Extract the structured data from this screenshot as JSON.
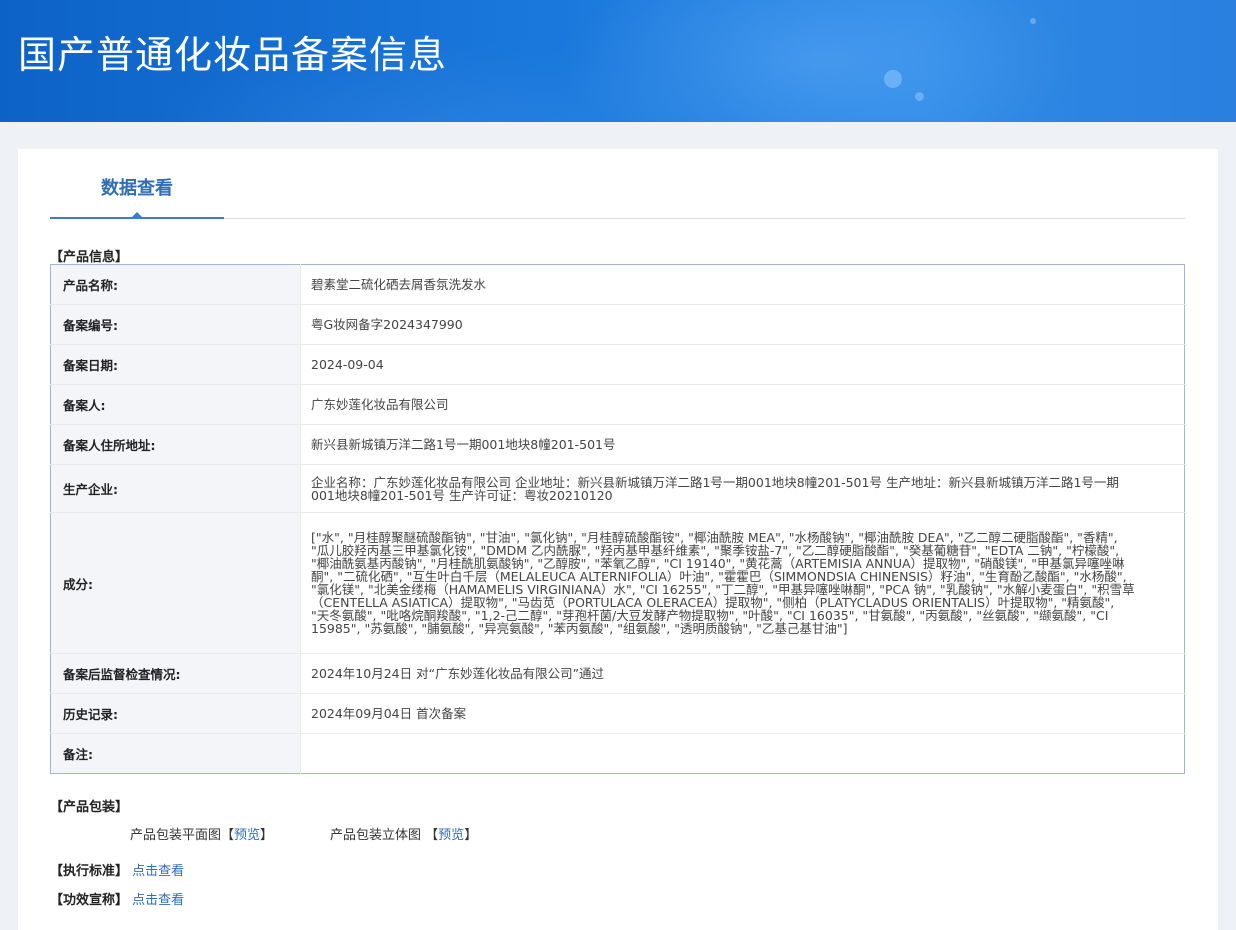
{
  "header": {
    "title": "国产普通化妆品备案信息"
  },
  "tabs": {
    "active_label": "数据查看"
  },
  "product_info": {
    "section_title": "【产品信息】",
    "rows": [
      {
        "label": "产品名称:",
        "value": "碧素堂二硫化硒去屑香氛洗发水"
      },
      {
        "label": "备案编号:",
        "value": "粤G妆网备字2024347990"
      },
      {
        "label": "备案日期:",
        "value": "2024-09-04"
      },
      {
        "label": "备案人:",
        "value": "广东妙莲化妆品有限公司"
      },
      {
        "label": "备案人住所地址:",
        "value": "新兴县新城镇万洋二路1号一期001地块8幢201-501号"
      },
      {
        "label": "生产企业:",
        "value": "企业名称：广东妙莲化妆品有限公司 企业地址：新兴县新城镇万洋二路1号一期001地块8幢201-501号 生产地址：新兴县新城镇万洋二路1号一期001地块8幢201-501号 生产许可证：粤妆20210120"
      },
      {
        "label": "成分:",
        "value": "[\"水\", \"月桂醇聚醚硫酸酯钠\", \"甘油\", \"氯化钠\", \"月桂醇硫酸酯铵\", \"椰油酰胺 MEA\", \"水杨酸钠\", \"椰油酰胺 DEA\", \"乙二醇二硬脂酸酯\", \"香精\", \"瓜儿胶羟丙基三甲基氯化铵\", \"DMDM 乙内酰脲\", \"羟丙基甲基纤维素\", \"聚季铵盐-7\", \"乙二醇硬脂酸酯\", \"癸基葡糖苷\", \"EDTA 二钠\", \"柠檬酸\", \"椰油酰氨基丙酸钠\", \"月桂酰肌氨酸钠\", \"乙醇胺\", \"苯氧乙醇\", \"CI 19140\", \"黄花蒿（ARTEMISIA ANNUA）提取物\", \"硝酸镁\", \"甲基氯异噻唑啉酮\", \"二硫化硒\", \"互生叶白千层（MELALEUCA ALTERNIFOLIA）叶油\", \"霍霍巴（SIMMONDSIA CHINENSIS）籽油\", \"生育酚乙酸酯\", \"水杨酸\", \"氯化镁\", \"北美金缕梅（HAMAMELIS VIRGINIANA）水\", \"CI 16255\", \"丁二醇\", \"甲基异噻唑啉酮\", \"PCA 钠\", \"乳酸钠\", \"水解小麦蛋白\", \"积雪草（CENTELLA ASIATICA）提取物\", \"马齿苋（PORTULACA OLERACEA）提取物\", \"侧柏（PLATYCLADUS ORIENTALIS）叶提取物\", \"精氨酸\", \"天冬氨酸\", \"吡咯烷酮羧酸\", \"1,2-己二醇\", \"芽孢杆菌/大豆发酵产物提取物\", \"叶酸\", \"CI 16035\", \"甘氨酸\", \"丙氨酸\", \"丝氨酸\", \"缬氨酸\", \"CI 15985\", \"苏氨酸\", \"脯氨酸\", \"异亮氨酸\", \"苯丙氨酸\", \"组氨酸\", \"透明质酸钠\", \"乙基己基甘油\"]"
      },
      {
        "label": "备案后监督检查情况:",
        "value": "2024年10月24日 对“广东妙莲化妆品有限公司”通过"
      },
      {
        "label": "历史记录:",
        "value": "2024年09月04日 首次备案"
      },
      {
        "label": "备注:",
        "value": ""
      }
    ]
  },
  "packaging": {
    "section_title": "【产品包装】",
    "flat_label": "产品包装平面图",
    "flat_open": "【",
    "flat_link": "预览",
    "flat_close": "】",
    "solid_label": "产品包装立体图",
    "solid_open": "【",
    "solid_link": "预览",
    "solid_close": "】"
  },
  "standard": {
    "label": "【执行标准】",
    "link": "点击查看"
  },
  "efficacy": {
    "label": "【功效宣称】",
    "link": "点击查看"
  }
}
